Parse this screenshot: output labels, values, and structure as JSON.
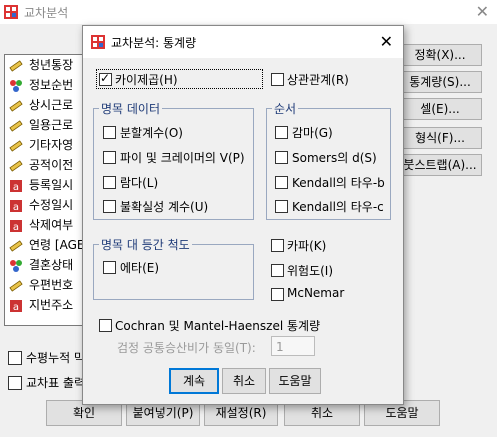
{
  "background": {
    "title": "교차분석",
    "variables": [
      {
        "label": "청년통장",
        "icon": "ruler-icon"
      },
      {
        "label": "정보순번",
        "icon": "nominal-icon"
      },
      {
        "label": "상시근로",
        "icon": "ruler-icon"
      },
      {
        "label": "일용근로",
        "icon": "ruler-icon"
      },
      {
        "label": "기타자영",
        "icon": "ruler-icon"
      },
      {
        "label": "공적이전",
        "icon": "ruler-icon"
      },
      {
        "label": "등록일시",
        "icon": "string-icon"
      },
      {
        "label": "수정일시",
        "icon": "string-icon"
      },
      {
        "label": "삭제여부",
        "icon": "string-icon"
      },
      {
        "label": "연령 [AGE",
        "icon": "ruler-icon"
      },
      {
        "label": "결혼상태",
        "icon": "nominal-icon"
      },
      {
        "label": "우편번호",
        "icon": "ruler-icon"
      },
      {
        "label": "지번주소",
        "icon": "string-icon"
      }
    ],
    "right_buttons": [
      "정확(X)...",
      "통계량(S)...",
      "셀(E)...",
      "형식(F)...",
      "붓스트랩(A)..."
    ],
    "checks": [
      "수평누적 막대",
      "교차표 출력"
    ],
    "bottom_buttons": [
      "확인",
      "붙여넣기(P)",
      "재설정(R)",
      "취소",
      "도움말"
    ]
  },
  "dialog": {
    "title": "교차분석: 통계량",
    "chisq": {
      "label": "카이제곱(H)",
      "checked": true
    },
    "correlations": {
      "label": "상관관계(R)",
      "checked": false
    },
    "nominal": {
      "title": "명목 데이터",
      "items": [
        {
          "label": "분할계수(O)",
          "checked": false
        },
        {
          "label": "파이 및 크레이머의 V(P)",
          "checked": false
        },
        {
          "label": "람다(L)",
          "checked": false
        },
        {
          "label": "불확실성 계수(U)",
          "checked": false
        }
      ]
    },
    "ordinal": {
      "title": "순서",
      "items": [
        {
          "label": "감마(G)",
          "checked": false
        },
        {
          "label": "Somers의 d(S)",
          "checked": false
        },
        {
          "label": "Kendall의 타우-b",
          "checked": false
        },
        {
          "label": "Kendall의 타우-c",
          "checked": false
        }
      ]
    },
    "nominal_interval": {
      "title": "명목 대 등간 척도",
      "items": [
        {
          "label": "에타(E)",
          "checked": false
        }
      ]
    },
    "other": [
      {
        "label": "카파(K)",
        "checked": false
      },
      {
        "label": "위험도(I)",
        "checked": false
      },
      {
        "label": "McNemar",
        "checked": false
      }
    ],
    "cmh": {
      "label": "Cochran 및 Mantel-Haenszel 통계량",
      "checked": false
    },
    "odds": {
      "label": "검정 공통승산비가 동일(T):",
      "value": "1"
    },
    "buttons": {
      "continue": "계속",
      "cancel": "취소",
      "help": "도움말"
    }
  }
}
